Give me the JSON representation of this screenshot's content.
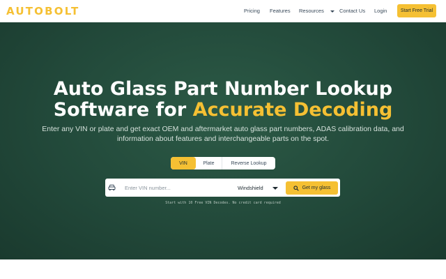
{
  "brand": {
    "logo": "AUTOBOLT",
    "accent": "#f5c033",
    "hero_bg": "#22493a"
  },
  "nav": {
    "items": [
      {
        "label": "Pricing"
      },
      {
        "label": "Features"
      },
      {
        "label": "Resources",
        "has_dropdown": true
      },
      {
        "label": "Contact Us"
      },
      {
        "label": "Login"
      }
    ],
    "cta_label": "Start Free Trial"
  },
  "hero": {
    "title_line1": "Auto Glass Part Number Lookup",
    "title_line2_plain": "Software for ",
    "title_line2_accent": "Accurate Decoding",
    "subtitle": "Enter any VIN or plate and get exact OEM and aftermarket auto glass part numbers, ADAS calibration data, and information about features and interchangeable parts on the spot."
  },
  "lookup_tabs": [
    {
      "label": "VIN",
      "active": true
    },
    {
      "label": "Plate",
      "active": false
    },
    {
      "label": "Reverse Lookup",
      "active": false
    }
  ],
  "search": {
    "icon": "car-icon",
    "placeholder": "Enter VIN number...",
    "value": "",
    "glass_type_selected": "Windshield",
    "submit_icon": "search-icon",
    "submit_label": "Get my glass",
    "note": "Start with 10 Free VIN Decodes. No credit card required"
  }
}
